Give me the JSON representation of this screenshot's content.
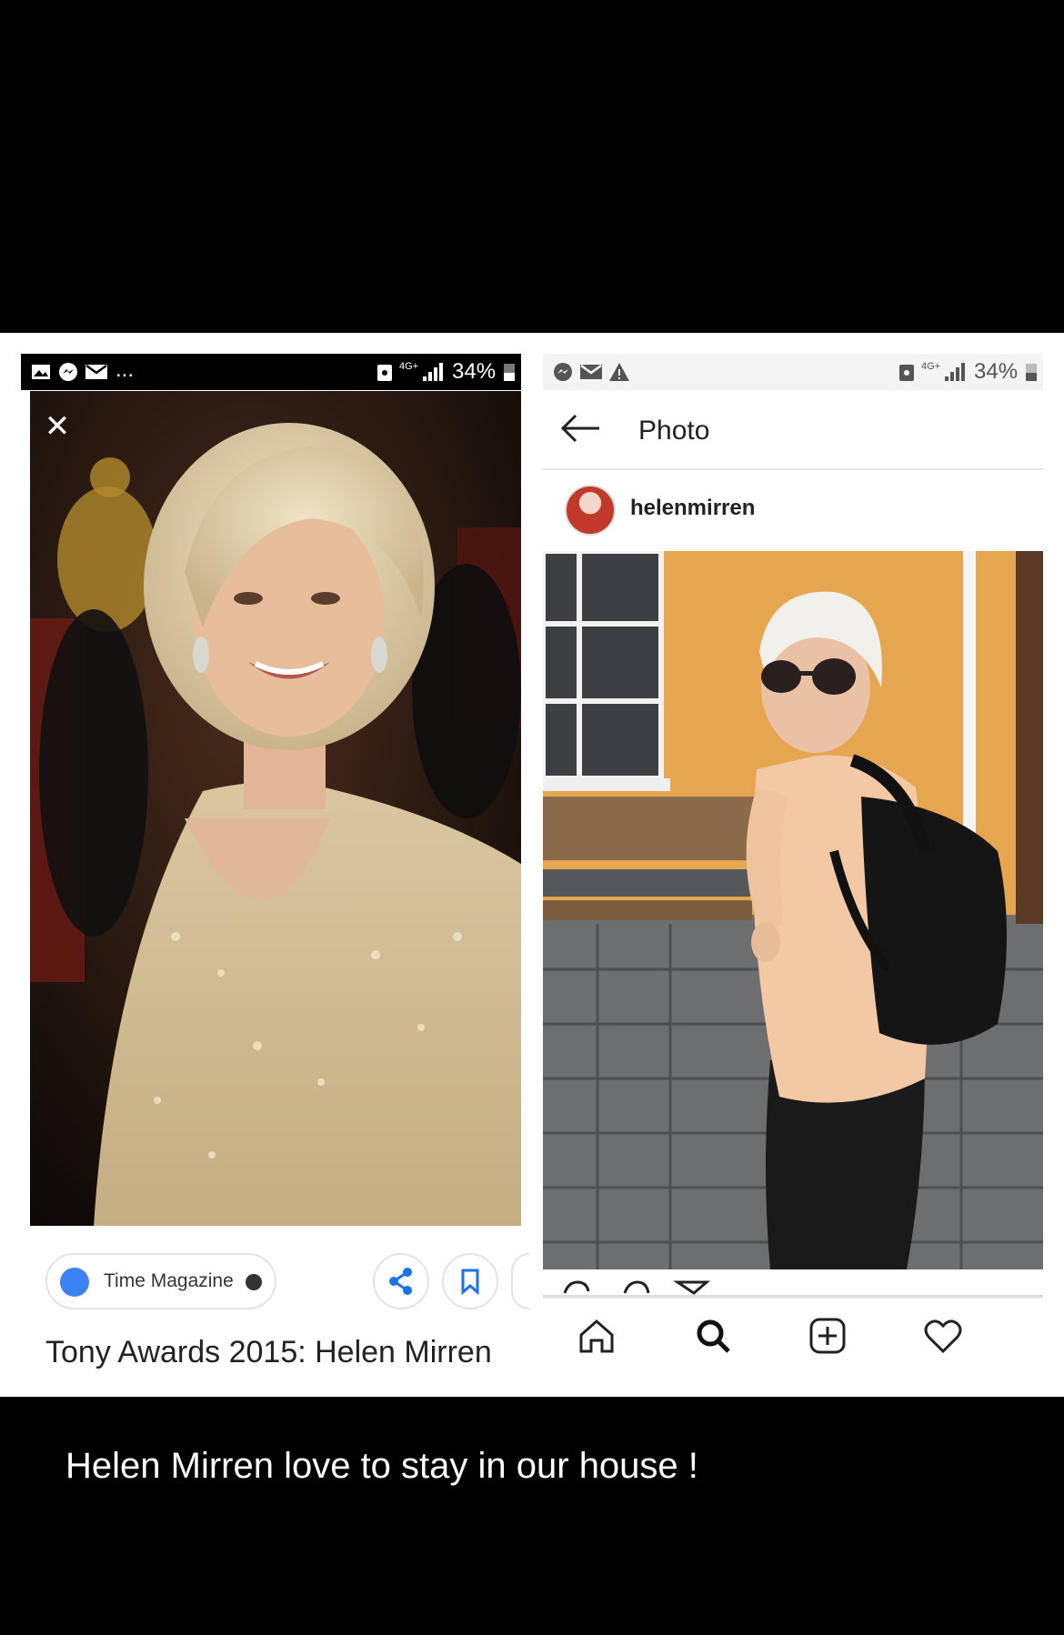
{
  "left": {
    "status": {
      "battery_percent": "34%"
    },
    "source_chip": {
      "label": "Time Magazine"
    },
    "caption": "Tony Awards 2015: Helen Mirren"
  },
  "right": {
    "status": {
      "battery_percent": "34%"
    },
    "header": {
      "title": "Photo"
    },
    "post": {
      "username": "helenmirren"
    }
  },
  "footer": {
    "caption": "Helen Mirren love to stay in our house !"
  }
}
